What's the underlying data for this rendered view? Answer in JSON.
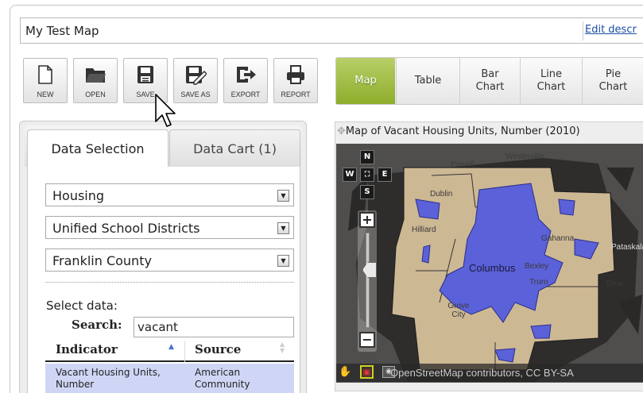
{
  "header": {
    "map_title": "My Test Map",
    "edit_link": "Edit descr"
  },
  "toolbar": [
    {
      "label": "NEW",
      "icon": "new-document-icon"
    },
    {
      "label": "OPEN",
      "icon": "folder-icon"
    },
    {
      "label": "SAVE",
      "icon": "floppy-disk-icon"
    },
    {
      "label": "SAVE AS",
      "icon": "save-as-icon"
    },
    {
      "label": "EXPORT",
      "icon": "export-icon"
    },
    {
      "label": "REPORT",
      "icon": "printer-icon"
    }
  ],
  "view_tabs": [
    {
      "label": "Map",
      "active": true
    },
    {
      "label": "Table",
      "active": false
    },
    {
      "label": "Bar Chart",
      "active": false
    },
    {
      "label": "Line Chart",
      "active": false
    },
    {
      "label": "Pie Chart",
      "active": false
    }
  ],
  "panel_tabs": {
    "data_selection": "Data Selection",
    "data_cart": "Data Cart (1)"
  },
  "dropdowns": {
    "topic": "Housing",
    "geography": "Unified School Districts",
    "area": "Franklin County"
  },
  "select_label": "Select data:",
  "search": {
    "label": "Search:",
    "value": "vacant"
  },
  "table": {
    "headers": [
      "Indicator",
      "Source"
    ],
    "rows": [
      {
        "indicator": "Vacant Housing Units, Number",
        "source": "American Community"
      }
    ]
  },
  "map": {
    "title": "Map of Vacant Housing Units, Number (2010)",
    "nav": {
      "n": "N",
      "w": "W",
      "e": "E",
      "s": "S"
    },
    "zoom_in": "+",
    "zoom_out": "−",
    "places": [
      "Powell",
      "Westerville",
      "Dublin",
      "Hilliard",
      "Gahanna",
      "Columbus",
      "Bexley",
      "Truro",
      "Grove City",
      "Etna",
      "Pataskala"
    ],
    "attribution": "OpenStreetMap contributors, CC BY-SA",
    "colors": {
      "highlight": "#5b61d8",
      "area": "#cdb894",
      "outside": "#4f4e4c"
    }
  }
}
